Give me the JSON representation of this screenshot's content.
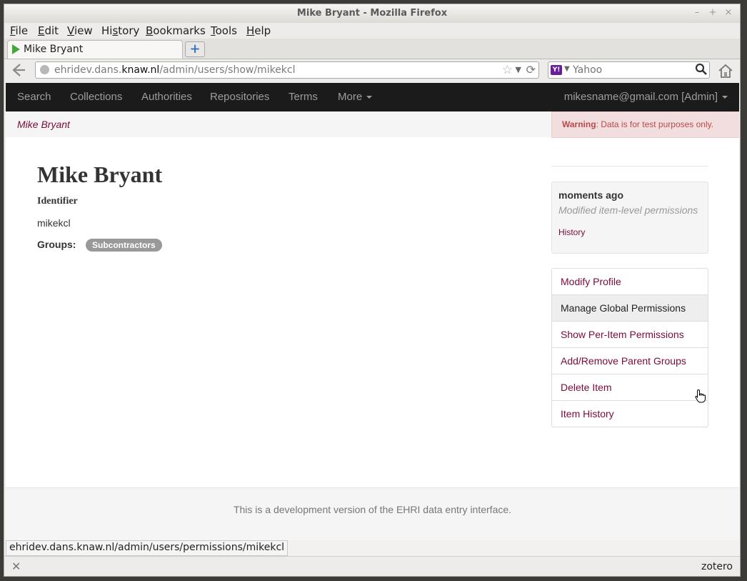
{
  "window": {
    "title": "Mike Bryant - Mozilla Firefox",
    "controls": [
      "–",
      "+",
      "×"
    ]
  },
  "menu": {
    "items": [
      {
        "underline": "F",
        "rest": "ile"
      },
      {
        "underline": "E",
        "rest": "dit"
      },
      {
        "underline": "V",
        "rest": "iew"
      },
      {
        "pre": "Hi",
        "underline": "s",
        "rest": "tory"
      },
      {
        "underline": "B",
        "rest": "ookmarks"
      },
      {
        "underline": "T",
        "rest": "ools"
      },
      {
        "underline": "H",
        "rest": "elp"
      }
    ]
  },
  "tab": {
    "label": "Mike Bryant",
    "new_tab": "+"
  },
  "address": {
    "url_prefix": "ehridev.dans.",
    "url_domain": "knaw.nl",
    "url_path": "/admin/users/show/mikekcl"
  },
  "search": {
    "placeholder": "Yahoo",
    "engine_icon": "Y!"
  },
  "sitenav": {
    "items": [
      "Search",
      "Collections",
      "Authorities",
      "Repositories",
      "Terms",
      "More"
    ],
    "user": "mikesname@gmail.com [Admin]"
  },
  "breadcrumb": "Mike Bryant",
  "warning": {
    "label": "Warning",
    "text": ": Data is for test purposes only."
  },
  "profile": {
    "name": "Mike Bryant",
    "identifier_label": "Identifier",
    "identifier": "mikekcl",
    "groups_label": "Groups:",
    "groups": [
      "Subcontractors"
    ]
  },
  "history_panel": {
    "when": "moments ago",
    "what": "Modified item-level permissions",
    "link": "History"
  },
  "actions": [
    "Modify Profile",
    "Manage Global Permissions",
    "Show Per-Item Permissions",
    "Add/Remove Parent Groups",
    "Delete Item",
    "Item History"
  ],
  "footer": "This is a development version of the EHRI data entry interface.",
  "status_url": "ehridev.dans.knaw.nl/admin/users/permissions/mikekcl",
  "addon_bar": {
    "close": "✕",
    "zotero": "zotero"
  },
  "colors": {
    "nav_bg": "#1b1b1b",
    "link": "#7a0a3a",
    "warning_bg": "#f2dede",
    "warning_text": "#b94a48"
  }
}
